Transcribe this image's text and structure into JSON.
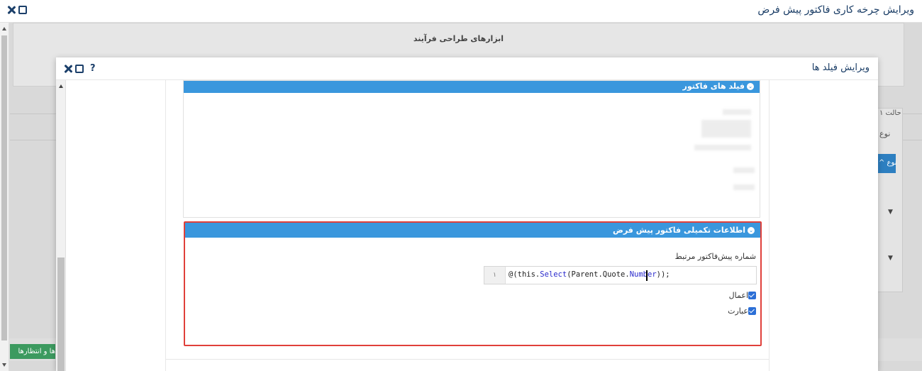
{
  "outer": {
    "title": "ویرایش چرخه کاری فاکتور پیش فرض",
    "background": {
      "tools_title": "ابزارهای طراحی فرآیند",
      "right_labels": [
        "حالت ۱",
        "نوع",
        "نوع ^"
      ],
      "green_button": "ها و انتظارها"
    }
  },
  "modal": {
    "title": "ویرایش فیلد ها",
    "help_label": "?",
    "section_invoice_fields": {
      "title": "فیلد های فاکتور"
    },
    "section_extra_info": {
      "title": "اطلاعات تکمیلی فاکتور پیش فرض",
      "related_quote_label": "شماره پیش‌فاکتور مرتبط",
      "code_line_number": "۱",
      "code_prefix": "@(this.",
      "code_select": "Select",
      "code_middle": "(Parent.Quote.",
      "code_number": "Number",
      "code_suffix": "));",
      "checkboxes": [
        {
          "label": "اعمال",
          "checked": true
        },
        {
          "label": "عبارت",
          "checked": true
        }
      ]
    }
  },
  "colors": {
    "section_header": "#3a97dd",
    "highlight_border": "#e0403a",
    "title_text": "#1a3d66",
    "checkbox": "#2c6fd6"
  }
}
